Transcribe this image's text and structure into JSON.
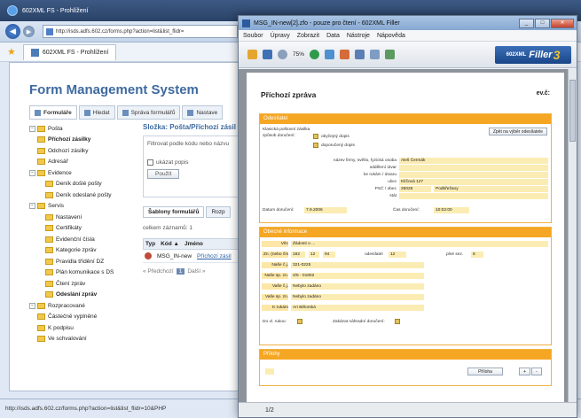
{
  "browser": {
    "title": "602XML FS - Prohlížení",
    "url": "http://isds.adfs.602.cz/forms.php?action=list&list_flidr=",
    "tab_label": "602XML FS - Prohlížení",
    "status_url": "http://isds.adfs.602.cz/forms.php?action=list&list_flidr=10&PHP"
  },
  "fms": {
    "title": "Form Management System",
    "tabs": [
      "Formuláře",
      "Hledat",
      "Správa formulářů",
      "Nastave"
    ],
    "tree": [
      {
        "label": "Pošta",
        "level": 0
      },
      {
        "label": "Příchozí zásilky",
        "level": 1,
        "bold": true
      },
      {
        "label": "Odchozí zásilky",
        "level": 1
      },
      {
        "label": "Adresář",
        "level": 1
      },
      {
        "label": "Evidence",
        "level": 0
      },
      {
        "label": "Deník došlé pošty",
        "level": 2
      },
      {
        "label": "Deník odeslané pošty",
        "level": 2
      },
      {
        "label": "Servis",
        "level": 0
      },
      {
        "label": "Nastavení",
        "level": 2
      },
      {
        "label": "Certifikáty",
        "level": 2
      },
      {
        "label": "Evidenční čísla",
        "level": 2
      },
      {
        "label": "Kategorie zpráv",
        "level": 2
      },
      {
        "label": "Pravidla třídění DZ",
        "level": 2
      },
      {
        "label": "Plán komunikace s DS",
        "level": 2
      },
      {
        "label": "Čtení zpráv",
        "level": 2
      },
      {
        "label": "Odeslání zpráv",
        "level": 2,
        "bold": true
      },
      {
        "label": "Rozpracované",
        "level": 0
      },
      {
        "label": "Částečně vyplněné",
        "level": 1
      },
      {
        "label": "K podpisu",
        "level": 1
      },
      {
        "label": "Ve schvalování",
        "level": 1
      }
    ],
    "folder_heading": "Složka: Pošta/Příchozí zásil",
    "filter_label": "Filtrovat podle kódu nebo názvu",
    "show_desc": "ukázat popis",
    "apply_button": "Použít",
    "subtabs": [
      "Šablony formulářů",
      "Rozp"
    ],
    "count_text": "celkem záznamů: 1",
    "table_headers": [
      "Typ",
      "Kód ▲",
      "Jméno"
    ],
    "rows": [
      {
        "code": "MSG_IN-new",
        "name": "Příchozí zásil"
      }
    ],
    "pager": {
      "prev": "« Předchozí",
      "page": "1",
      "next": "Další »"
    }
  },
  "filler": {
    "title": "MSG_IN-new[2].zfo - pouze pro čtení - 602XML Filler",
    "menu": [
      "Soubor",
      "Úpravy",
      "Zobrazit",
      "Data",
      "Nástroje",
      "Nápověda"
    ],
    "zoom": "75%",
    "logo_small": "602XML",
    "logo_main": "Filler",
    "logo_num": "3",
    "page_status": "1/2",
    "doc_title": "Příchozí zpráva",
    "doc_ev": "ev.č:",
    "sections": {
      "sender": "Odesílatel",
      "general": "Obecné informace",
      "attachments": "Přílohy"
    },
    "sender": {
      "mailbox_label": "Klasická poštovní zásilka",
      "delivery_label": "způsob doručení:",
      "opt_regular": "obyčejný dopis",
      "opt_registered": "doporučený dopis",
      "back_button": "Zpět na výběr odesílatele",
      "company_label": "název firmy, světlo, fyzická osoba",
      "company_value": "Aleš Čermák",
      "dept_label": "oddělení útvar",
      "person_label": "ke rukám / útvaru",
      "street_label": "ulice",
      "street_value": "Klíčová 127",
      "psc_label": "PSČ / obec",
      "psc_value": "25026",
      "city_value": "Podbřežany",
      "state_label": "stát",
      "date_label": "Datum doručení:",
      "date_value": "7.9.2006",
      "time_label": "Čas doručení:",
      "time_value": "10:02:00"
    },
    "general": {
      "subject_label": "Věc",
      "subject_value": "Žádosti o ...",
      "ref_label": "Zn. (nebo číslo)",
      "ref1": "182",
      "ref2": "12",
      "ref3": "94",
      "sender_no_label": "odesílatel",
      "sender_no": "12",
      "recv_label": "plné sez.",
      "recv_val": "8",
      "yours_label": "Naše č.j.",
      "yours_value": "321-0225",
      "ours_label": "Naše sp. zn.",
      "ours_value": "4/5 - 01802",
      "your_ref_label": "Vaše č.j.",
      "your_ref_value": "Nebylo zadáno",
      "your_sp_label": "Vaše sp. zn.",
      "your_sp_value": "Nebylo zadáno",
      "kr_label": "K rukám",
      "kr_value": "Ari Bělorská",
      "own_hands": "Do vl. rukou:",
      "substitute": "Zakázat náhradní doručení:"
    },
    "attachments": {
      "file_button": "Příloha",
      "plus": "+",
      "minus": "-"
    }
  }
}
